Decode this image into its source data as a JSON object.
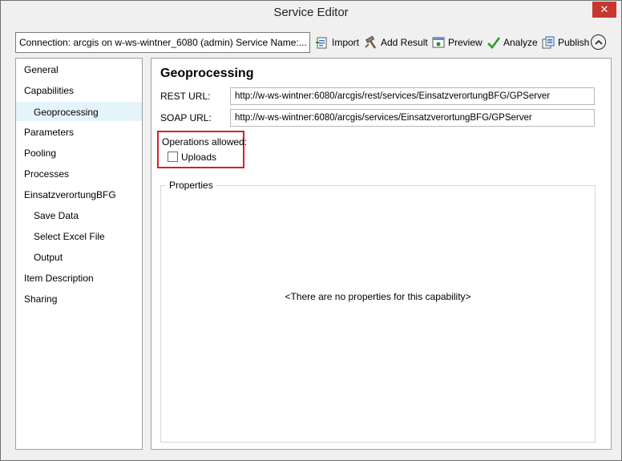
{
  "window": {
    "title": "Service Editor",
    "close_glyph": "✕"
  },
  "toolbar": {
    "connection_text": "Connection: arcgis on w-ws-wintner_6080 (admin)   Service Name:...",
    "import_label": "Import",
    "add_result_label": "Add Result",
    "preview_label": "Preview",
    "analyze_label": "Analyze",
    "publish_label": "Publish"
  },
  "sidebar": {
    "items": [
      {
        "label": "General"
      },
      {
        "label": "Capabilities"
      },
      {
        "label": "Geoprocessing"
      },
      {
        "label": "Parameters"
      },
      {
        "label": "Pooling"
      },
      {
        "label": "Processes"
      },
      {
        "label": "EinsatzverortungBFG"
      },
      {
        "label": "Save Data"
      },
      {
        "label": "Select Excel File"
      },
      {
        "label": "Output"
      },
      {
        "label": "Item Description"
      },
      {
        "label": "Sharing"
      }
    ]
  },
  "main": {
    "heading": "Geoprocessing",
    "rest_url_label": "REST URL:",
    "rest_url_value": "http://w-ws-wintner:6080/arcgis/rest/services/EinsatzverortungBFG/GPServer",
    "soap_url_label": "SOAP URL:",
    "soap_url_value": "http://w-ws-wintner:6080/arcgis/services/EinsatzverortungBFG/GPServer",
    "operations_label": "Operations allowed:",
    "uploads_label": "Uploads",
    "uploads_checked": false,
    "properties_title": "Properties",
    "properties_empty": "<There are no properties for this capability>"
  },
  "colors": {
    "highlight_border": "#d6202a",
    "close_button": "#c7372f",
    "selected_item": "#e5f3fb"
  }
}
